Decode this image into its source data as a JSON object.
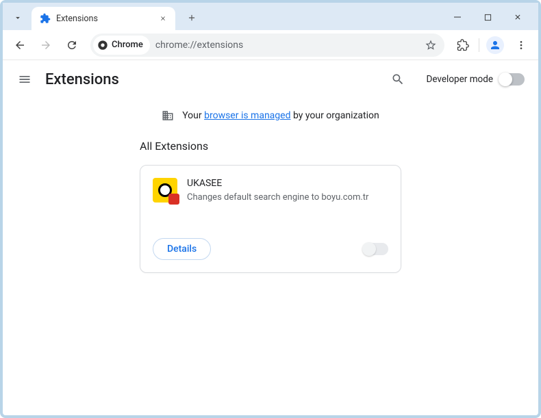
{
  "tab": {
    "title": "Extensions"
  },
  "toolbar": {
    "chrome_label": "Chrome",
    "url": "chrome://extensions"
  },
  "header": {
    "title": "Extensions",
    "dev_mode_label": "Developer mode"
  },
  "banner": {
    "prefix": "Your ",
    "link": "browser is managed",
    "suffix": " by your organization"
  },
  "content": {
    "section_title": "All Extensions",
    "extension": {
      "name": "UKASEE",
      "description": "Changes default search engine to boyu.com.tr",
      "details_label": "Details"
    }
  }
}
